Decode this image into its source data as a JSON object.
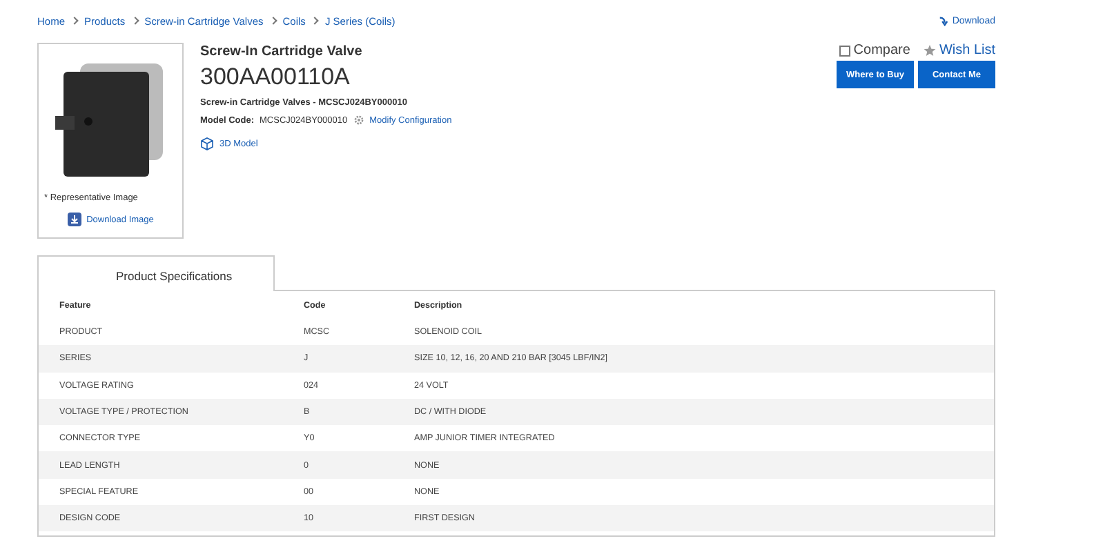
{
  "breadcrumb": [
    "Home",
    "Products",
    "Screw-in Cartridge Valves",
    "Coils",
    "J Series (Coils)"
  ],
  "download": "Download",
  "product": {
    "category": "Screw-In Cartridge Valve",
    "part_number": "300AA00110A",
    "subtitle": "Screw-in Cartridge Valves - MCSCJ024BY000010",
    "model_code_label": "Model Code:",
    "model_code": "MCSCJ024BY000010",
    "modify": "Modify Configuration",
    "model_3d": "3D Model"
  },
  "image": {
    "caption": "* Representative Image",
    "download": "Download Image"
  },
  "compare": {
    "label": "Compare",
    "checked": false
  },
  "wish_list": "Wish List",
  "buttons": [
    "Where to Buy",
    "Contact Me"
  ],
  "tabs": [
    {
      "label": "Product Specifications",
      "selected": true
    }
  ],
  "table": {
    "columns": [
      "Feature",
      "Code",
      "Description"
    ],
    "rows": [
      [
        "PRODUCT",
        "MCSC",
        "SOLENOID COIL"
      ],
      [
        "SERIES",
        "J",
        "SIZE 10, 12, 16, 20 AND 210 BAR [3045 LBF/IN2]"
      ],
      [
        "VOLTAGE RATING",
        "024",
        "24 VOLT"
      ],
      [
        "VOLTAGE TYPE / PROTECTION",
        "B",
        "DC / WITH DIODE"
      ],
      [
        "CONNECTOR TYPE",
        "Y0",
        "AMP JUNIOR TIMER INTEGRATED"
      ],
      [
        "LEAD LENGTH",
        "0",
        "NONE"
      ],
      [
        "SPECIAL FEATURE",
        "00",
        "NONE"
      ],
      [
        "DESIGN CODE",
        "10",
        "FIRST DESIGN"
      ]
    ]
  }
}
